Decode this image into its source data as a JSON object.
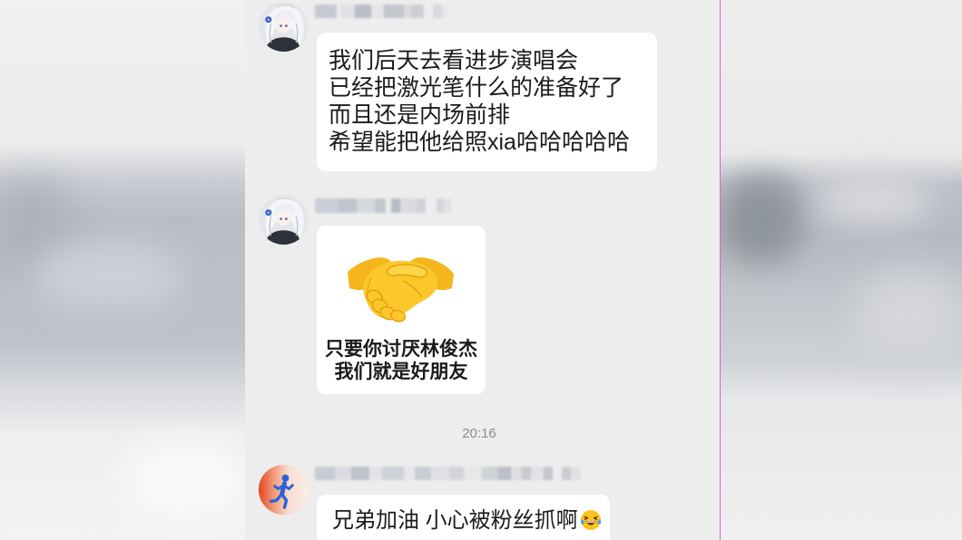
{
  "chat": {
    "messages": [
      {
        "avatar_icon": "anime-girl-avatar-icon",
        "lines": [
          "我们后天去看进步演唱会",
          "已经把激光笔什么的准备好了",
          "而且还是内场前排",
          "希望能把他给照xia哈哈哈哈哈"
        ]
      },
      {
        "avatar_icon": "anime-girl-avatar-icon",
        "sticker_icon": "handshake-icon",
        "caption_lines": [
          "只要你讨厌林俊杰",
          "我们就是好朋友"
        ]
      },
      {
        "avatar_icon": "runner-avatar-icon",
        "text": "兄弟加油 小心被粉丝抓啊",
        "emoji_icon": "face-with-tears-of-joy-icon"
      }
    ],
    "timestamp": "20:16"
  },
  "colors": {
    "chat_background": "#ededed",
    "bubble_background": "#ffffff",
    "message_text": "#1b1b1b",
    "timestamp_text": "#8d8d8d",
    "frame_divider": "#e35ccf"
  }
}
